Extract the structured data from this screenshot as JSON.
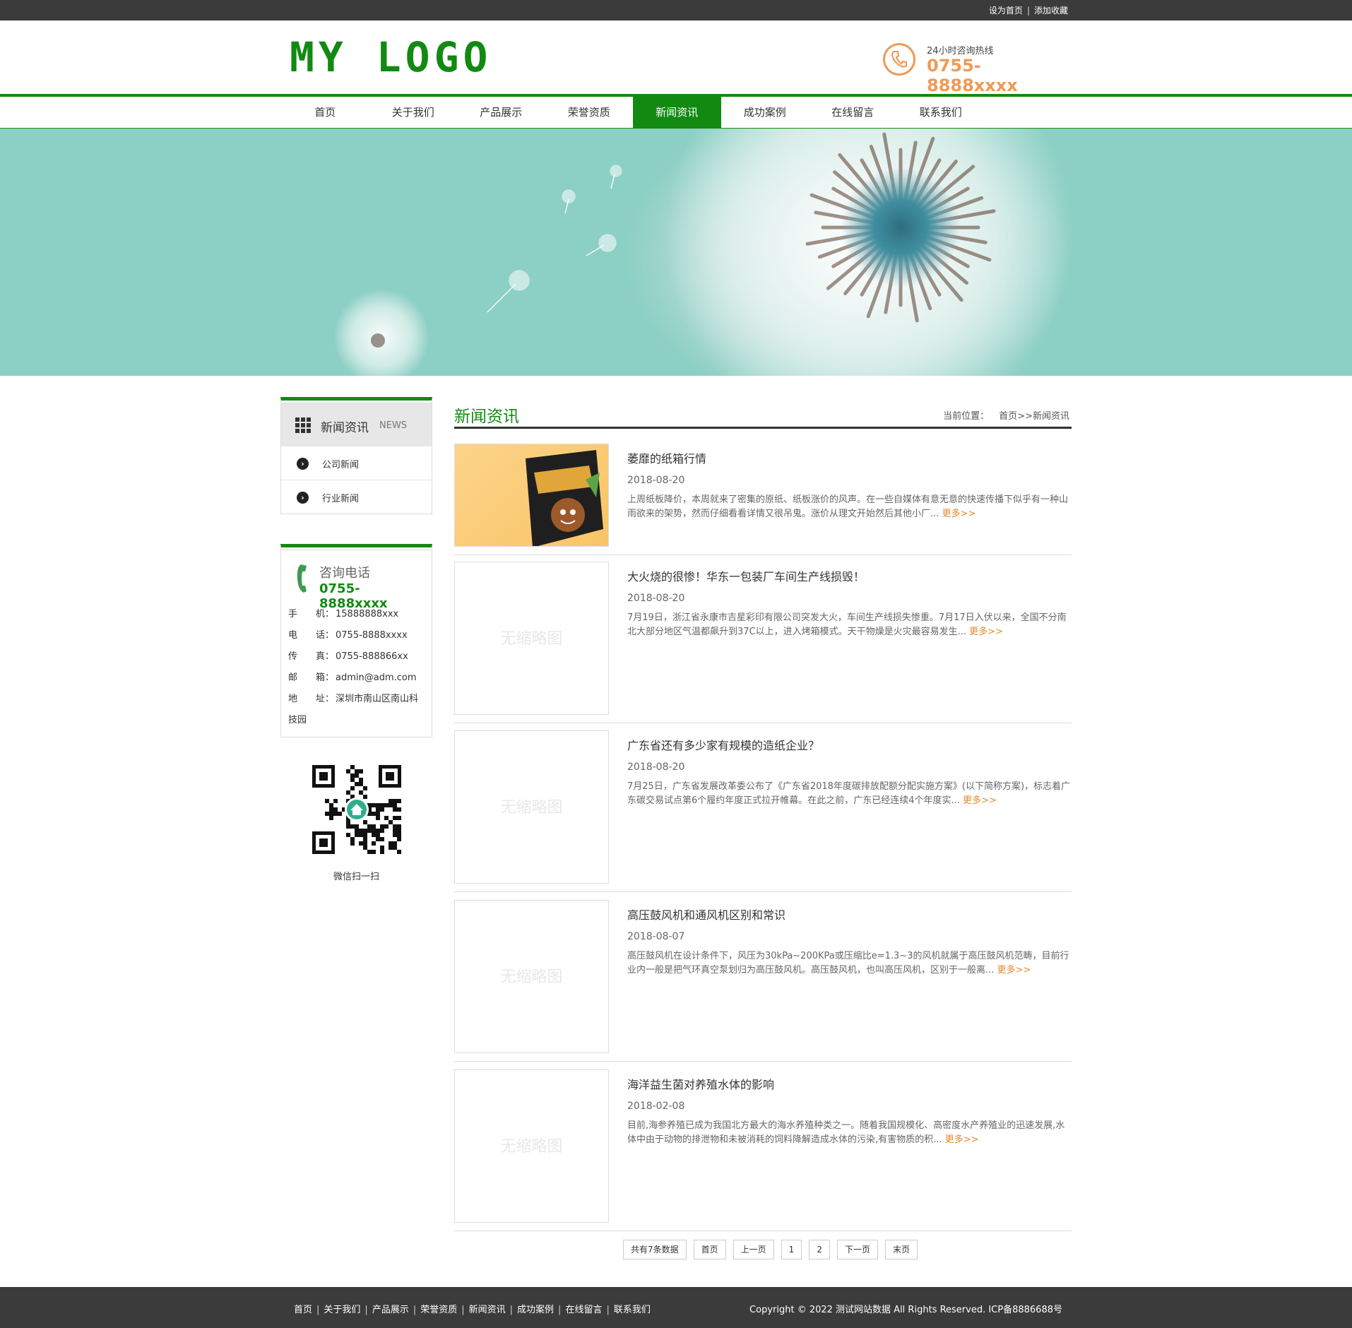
{
  "topbar": {
    "set_home": "设为首页",
    "separator": "|",
    "add_favorite": "添加收藏"
  },
  "header": {
    "logo": "MY LOGO",
    "hotline_label": "24小时咨询热线",
    "hotline_number": "0755-8888xxxx"
  },
  "nav": {
    "items": [
      "首页",
      "关于我们",
      "产品展示",
      "荣誉资质",
      "新闻资讯",
      "成功案例",
      "在线留言",
      "联系我们"
    ],
    "active": "新闻资讯"
  },
  "sidebar": {
    "title": "新闻资讯",
    "title_en": "NEWS",
    "items": [
      "公司新闻",
      "行业新闻"
    ]
  },
  "contact": {
    "title": "咨询电话",
    "number": "0755-8888xxxx",
    "lines": [
      {
        "key": "手　　机：",
        "value": "15888888xxx"
      },
      {
        "key": "电　　话：",
        "value": "0755-8888xxxx"
      },
      {
        "key": "传　　真：",
        "value": "0755-888866xx"
      },
      {
        "key": "邮　　箱：",
        "value": "admin@adm.com"
      },
      {
        "key": "地　　址：",
        "value": "深圳市南山区南山科技园"
      }
    ]
  },
  "qr": {
    "label": "微信扫一扫"
  },
  "main": {
    "title": "新闻资讯",
    "breadcrumb_label": "当前位置：",
    "breadcrumb_home": "首页",
    "breadcrumb_sep": ">>",
    "breadcrumb_current": "新闻资讯"
  },
  "news": [
    {
      "title": "萎靡的纸箱行情",
      "date": "2018-08-20",
      "desc": "上周纸板降价，本周就来了密集的原纸、纸板涨价的风声。在一些自媒体有意无意的快速传播下似乎有一种山雨欲来的架势，然而仔细看看详情又很吊鬼。涨价从理文开始然后其他小厂...",
      "has_image": true,
      "placeholder": "",
      "more": "更多>>"
    },
    {
      "title": "大火烧的很惨！华东一包装厂车间生产线损毁！",
      "date": "2018-08-20",
      "desc": "7月19日，浙江省永康市吉星彩印有限公司突发大火，车间生产线损失惨重。7月17日入伏以来，全国不分南北大部分地区气温都飙升到37C以上，进入烤箱模式。天干物燥是火灾最容易发生...",
      "has_image": false,
      "placeholder": "无缩略图",
      "more": "更多>>"
    },
    {
      "title": "广东省还有多少家有规模的造纸企业？",
      "date": "2018-08-20",
      "desc": "7月25日，广东省发展改革委公布了《广东省2018年度碳排放配额分配实施方案》(以下简称方案)，标志着广东碳交易试点第6个履约年度正式拉开帷幕。在此之前，广东已经连续4个年度实...",
      "has_image": false,
      "placeholder": "无缩略图",
      "more": "更多>>"
    },
    {
      "title": "高压鼓风机和通风机区别和常识",
      "date": "2018-08-07",
      "desc": "高压鼓风机在设计条件下，风压为30kPa~200KPa或压缩比e=1.3~3的风机就属于高压鼓风机范畴，目前行业内一般是把气环真空泵划归为高压鼓风机。高压鼓风机，也叫高压风机，区别于一般离...",
      "has_image": false,
      "placeholder": "无缩略图",
      "more": "更多>>"
    },
    {
      "title": "海洋益生菌对养殖水体的影响",
      "date": "2018-02-08",
      "desc": "目前,海参养殖已成为我国北方最大的海水养殖种类之一。随着我国规模化、高密度水产养殖业的迅速发展,水体中由于动物的排泄物和未被消耗的饲料降解造成水体的污染,有害物质的积...",
      "has_image": false,
      "placeholder": "无缩略图",
      "more": "更多>>"
    }
  ],
  "pager": {
    "info": "共有7条数据",
    "first": "首页",
    "prev": "上一页",
    "pages": [
      "1",
      "2"
    ],
    "next": "下一页",
    "last": "末页"
  },
  "footer": {
    "links": [
      "首页",
      "关于我们",
      "产品展示",
      "荣誉资质",
      "新闻资讯",
      "成功案例",
      "在线留言",
      "联系我们"
    ],
    "separator": "|",
    "copyright": "Copyright © 2022 测试网站数据 All Rights Reserved. ICP备8886688号"
  },
  "colors": {
    "brand_green": "#128a12",
    "accent_orange": "#ef9a57",
    "more_orange": "#e2892c",
    "dark_bar": "#3b3b3b"
  },
  "icons": [
    "phone-icon",
    "grid-icon",
    "chevron-right-icon",
    "handset-icon",
    "qr-code-icon",
    "home-icon"
  ]
}
